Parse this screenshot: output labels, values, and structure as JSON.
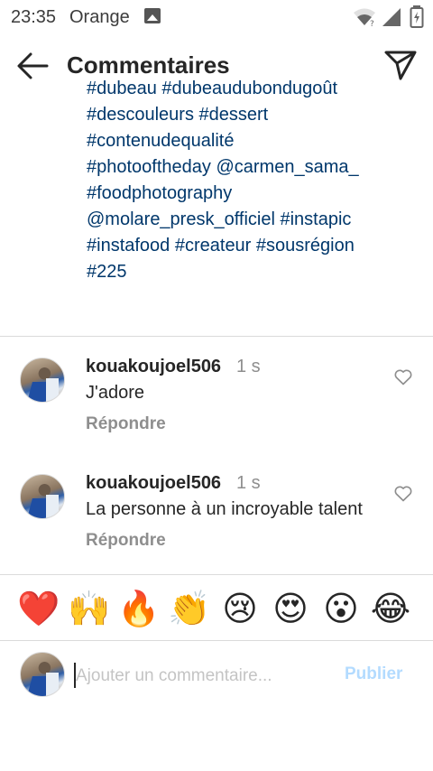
{
  "status_bar": {
    "time": "23:35",
    "carrier": "Orange",
    "icons": [
      "gallery-icon",
      "wifi-icon",
      "signal-icon",
      "battery-icon"
    ]
  },
  "header": {
    "title": "Commentaires",
    "back_icon": "arrow-left-icon",
    "share_icon": "send-icon"
  },
  "caption": {
    "lines": [
      "#dubeau #dubeaudubondugoût",
      "#descouleurs #dessert",
      "#contenudequalité",
      "#photooftheday @carmen_sama_",
      "#foodphotography",
      "@molare_presk_officiel #instapic",
      "#instafood #createur #sousrégion",
      "#225"
    ]
  },
  "comments": [
    {
      "user": "kouakoujoel506",
      "time": "1 s",
      "text": "J'adore",
      "reply_label": "Répondre"
    },
    {
      "user": "kouakoujoel506",
      "time": "1 s",
      "text": "La personne à un incroyable talent",
      "reply_label": "Répondre"
    }
  ],
  "quick_reactions": [
    "❤️",
    "🙌",
    "🔥",
    "👏",
    "😢",
    "😍",
    "😮",
    "😂"
  ],
  "composer": {
    "placeholder": "Ajouter un commentaire...",
    "publish_label": "Publier"
  },
  "colors": {
    "link": "#00376b",
    "muted": "#8e8e8e",
    "publish_disabled": "#b3dbff",
    "divider": "#dbdbdb"
  }
}
